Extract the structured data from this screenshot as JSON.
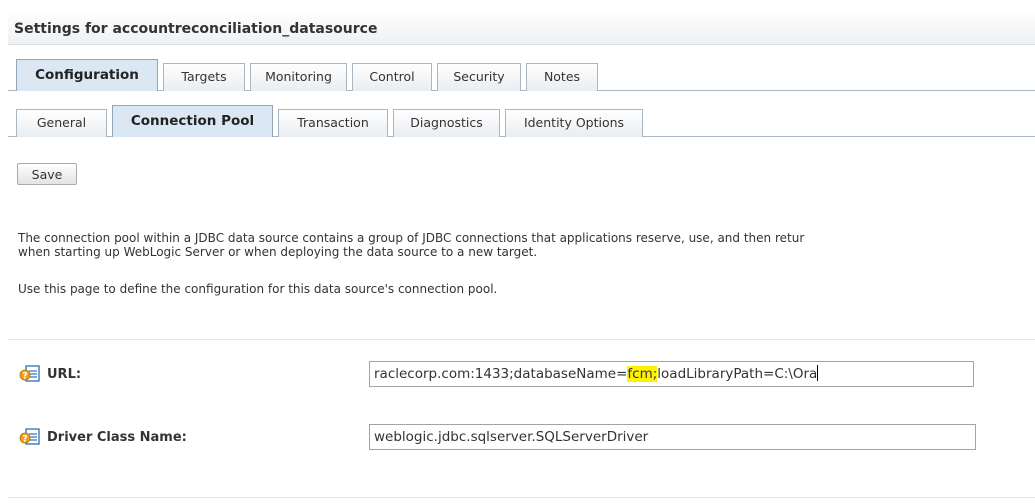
{
  "header": {
    "title": "Settings for accountreconciliation_datasource"
  },
  "tabs_top": [
    {
      "label": "Configuration",
      "active": true
    },
    {
      "label": "Targets",
      "active": false
    },
    {
      "label": "Monitoring",
      "active": false
    },
    {
      "label": "Control",
      "active": false
    },
    {
      "label": "Security",
      "active": false
    },
    {
      "label": "Notes",
      "active": false
    }
  ],
  "tabs_sub": [
    {
      "label": "General",
      "active": false
    },
    {
      "label": "Connection Pool",
      "active": true
    },
    {
      "label": "Transaction",
      "active": false
    },
    {
      "label": "Diagnostics",
      "active": false
    },
    {
      "label": "Identity Options",
      "active": false
    }
  ],
  "actions": {
    "save_label": "Save"
  },
  "description": {
    "line1": "The connection pool within a JDBC data source contains a group of JDBC connections that applications reserve, use, and then retur",
    "line2": "when starting up WebLogic Server or when deploying the data source to a new target.",
    "line3": "Use this page to define the configuration for this data source's connection pool."
  },
  "fields": {
    "url": {
      "label": "URL:",
      "value_before": "raclecorp.com:1433;databaseName=",
      "value_highlight": "fcm;",
      "value_after": "loadLibraryPath=C:\\Ora",
      "highlight_color": "#fff200",
      "icon": "help-icon"
    },
    "driver": {
      "label": "Driver Class Name:",
      "value": "weblogic.jdbc.sqlserver.SQLServerDriver",
      "icon": "help-icon"
    }
  }
}
